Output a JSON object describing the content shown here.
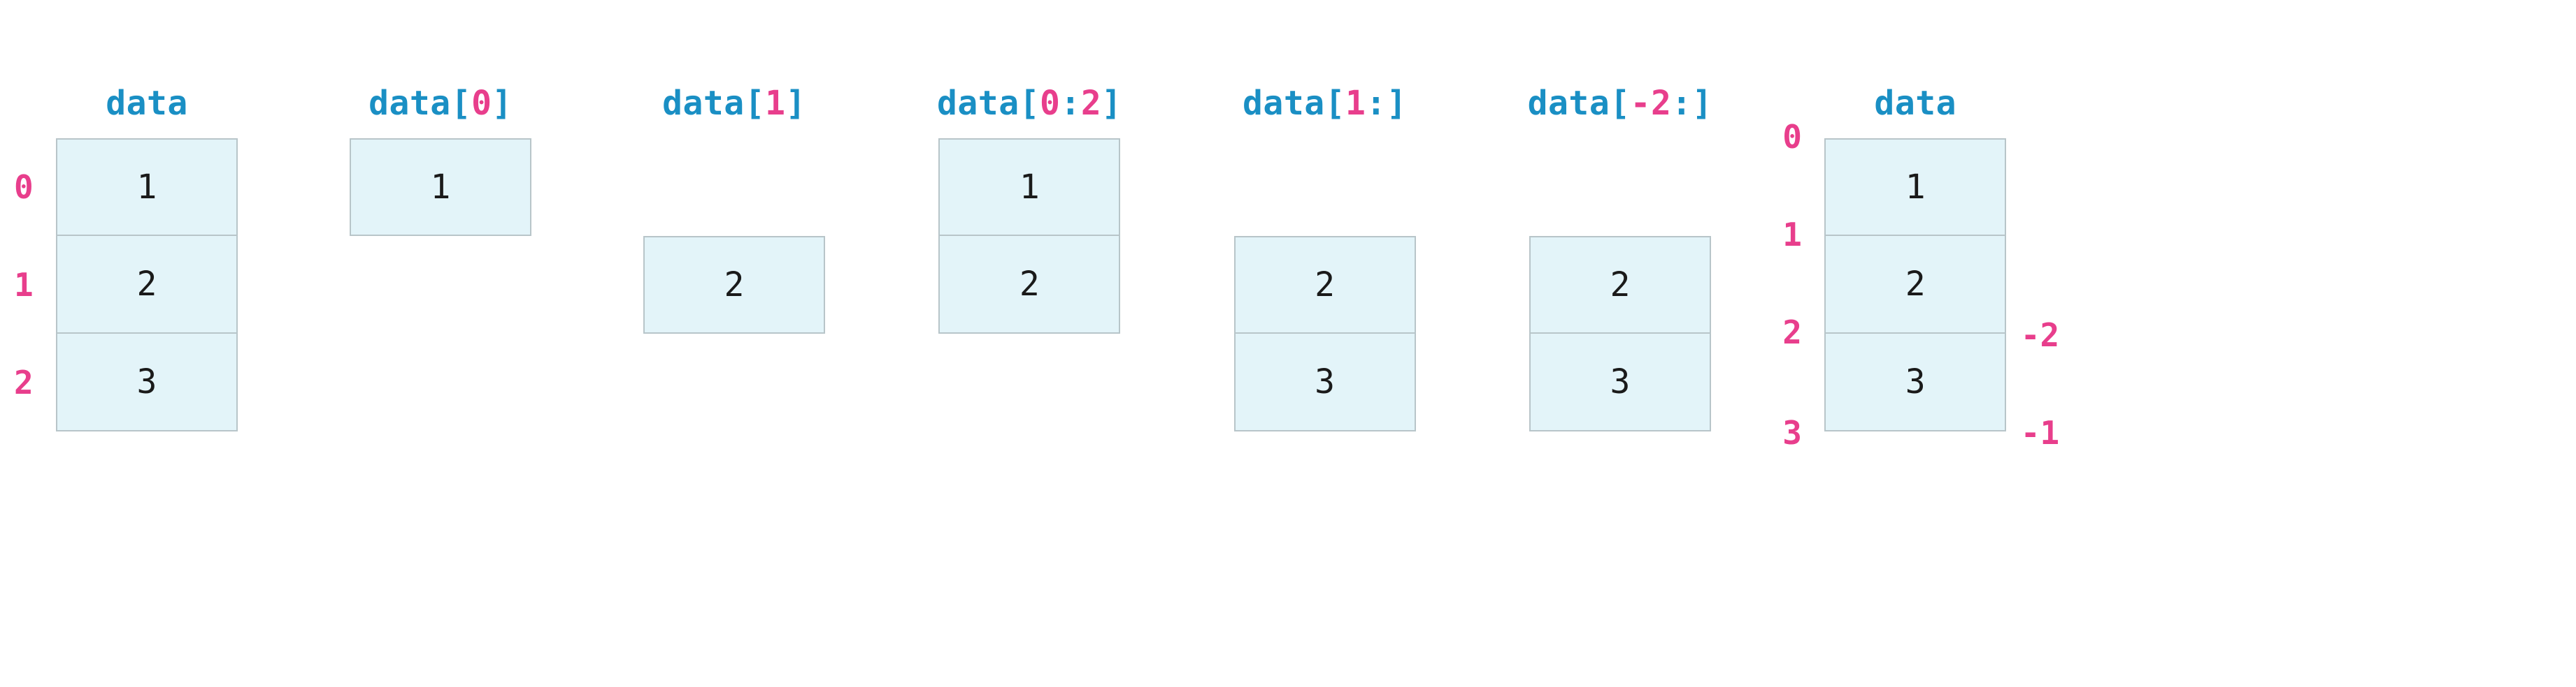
{
  "colors": {
    "keyword": "#1a8fc4",
    "accent": "#e83e8c",
    "value": "#1a1a1a",
    "cell_bg": "#e3f4f9",
    "cell_border": "#b8c5c9"
  },
  "panels": [
    {
      "id": "p0",
      "title_parts": [
        {
          "text": "data",
          "color": "blue"
        }
      ],
      "index_mode": "element",
      "rows": [
        {
          "value": "1",
          "left_idx": "0"
        },
        {
          "value": "2",
          "left_idx": "1"
        },
        {
          "value": "3",
          "left_idx": "2"
        }
      ]
    },
    {
      "id": "p1",
      "title_parts": [
        {
          "text": "data[",
          "color": "blue"
        },
        {
          "text": "0",
          "color": "magenta"
        },
        {
          "text": "]",
          "color": "blue"
        }
      ],
      "index_mode": "element",
      "rows": [
        {
          "value": "1"
        }
      ]
    },
    {
      "id": "p2",
      "title_parts": [
        {
          "text": "data[",
          "color": "blue"
        },
        {
          "text": "1",
          "color": "magenta"
        },
        {
          "text": "]",
          "color": "blue"
        }
      ],
      "index_mode": "element",
      "top_gap_rows": 1,
      "rows": [
        {
          "value": "2"
        }
      ]
    },
    {
      "id": "p3",
      "title_parts": [
        {
          "text": "data[",
          "color": "blue"
        },
        {
          "text": "0",
          "color": "magenta"
        },
        {
          "text": ":",
          "color": "blue"
        },
        {
          "text": "2",
          "color": "magenta"
        },
        {
          "text": "]",
          "color": "blue"
        }
      ],
      "index_mode": "element",
      "rows": [
        {
          "value": "1"
        },
        {
          "value": "2"
        }
      ]
    },
    {
      "id": "p4",
      "title_parts": [
        {
          "text": "data[",
          "color": "blue"
        },
        {
          "text": "1",
          "color": "magenta"
        },
        {
          "text": ":]",
          "color": "blue"
        }
      ],
      "index_mode": "element",
      "top_gap_rows": 1,
      "rows": [
        {
          "value": "2"
        },
        {
          "value": "3"
        }
      ]
    },
    {
      "id": "p5",
      "title_parts": [
        {
          "text": "data[",
          "color": "blue"
        },
        {
          "text": "-2",
          "color": "magenta"
        },
        {
          "text": ":]",
          "color": "blue"
        }
      ],
      "index_mode": "element",
      "top_gap_rows": 1,
      "rows": [
        {
          "value": "2"
        },
        {
          "value": "3"
        }
      ]
    },
    {
      "id": "p6",
      "title_parts": [
        {
          "text": "data",
          "color": "blue"
        }
      ],
      "index_mode": "edge",
      "rows": [
        {
          "value": "1",
          "left_idx": "0"
        },
        {
          "value": "2",
          "left_idx": "1",
          "right_idx": "-2"
        },
        {
          "value": "3",
          "left_idx": "2",
          "right_idx": "-1"
        }
      ],
      "terminal_left_idx": "3"
    }
  ]
}
